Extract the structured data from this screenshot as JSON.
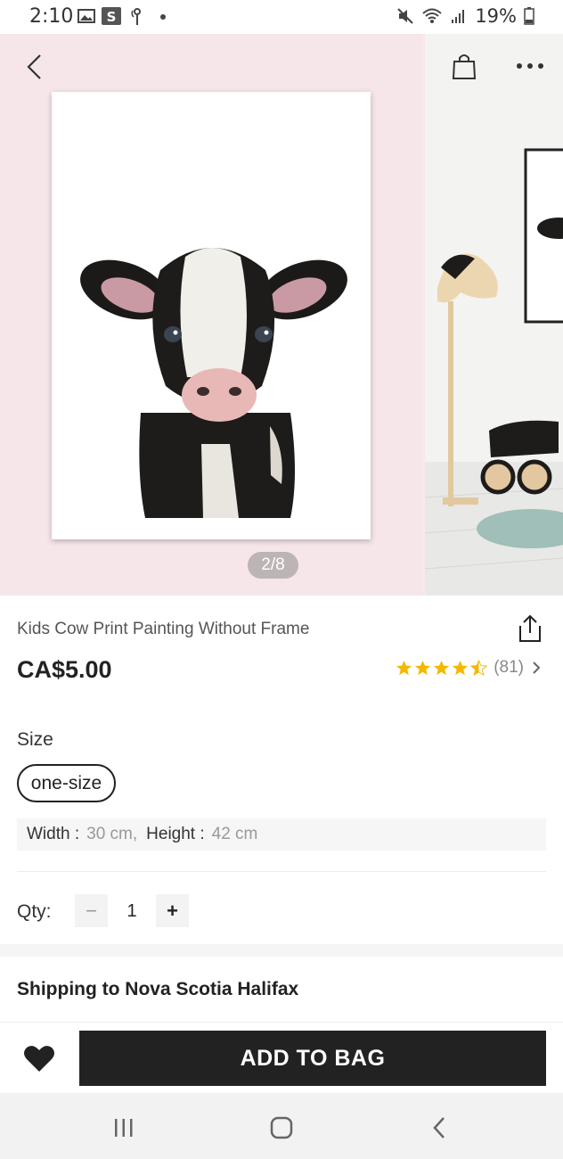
{
  "status_bar": {
    "time": "2:10",
    "battery": "19%",
    "icons": [
      "image-icon",
      "s-app-icon",
      "notification-icon",
      "dot-icon",
      "mute-icon",
      "wifi-icon",
      "signal-icon",
      "battery-icon"
    ]
  },
  "gallery": {
    "page_indicator": "2/8",
    "icons": {
      "back": "back-arrow-icon",
      "bag": "shopping-bag-icon",
      "more": "more-dots-icon"
    }
  },
  "product": {
    "title": "Kids Cow Print Painting Without Frame",
    "price": "CA$5.00",
    "rating": {
      "stars": 4.5,
      "count_text": "(81)"
    },
    "size_label": "Size",
    "size_option": "one-size",
    "dimensions": {
      "width_key": "Width :",
      "width_value": "30 cm,",
      "height_key": "Height :",
      "height_value": "42 cm"
    },
    "qty_label": "Qty:",
    "qty_value": "1",
    "qty_minus": "−",
    "qty_plus": "+"
  },
  "shipping": {
    "text": "Shipping to Nova Scotia Halifax"
  },
  "actions": {
    "add_to_bag": "ADD TO BAG",
    "wishlist_icon": "heart-icon"
  },
  "colors": {
    "accent": "#222222",
    "star": "#f5b800",
    "gallery_bg": "#f6e6e9"
  }
}
